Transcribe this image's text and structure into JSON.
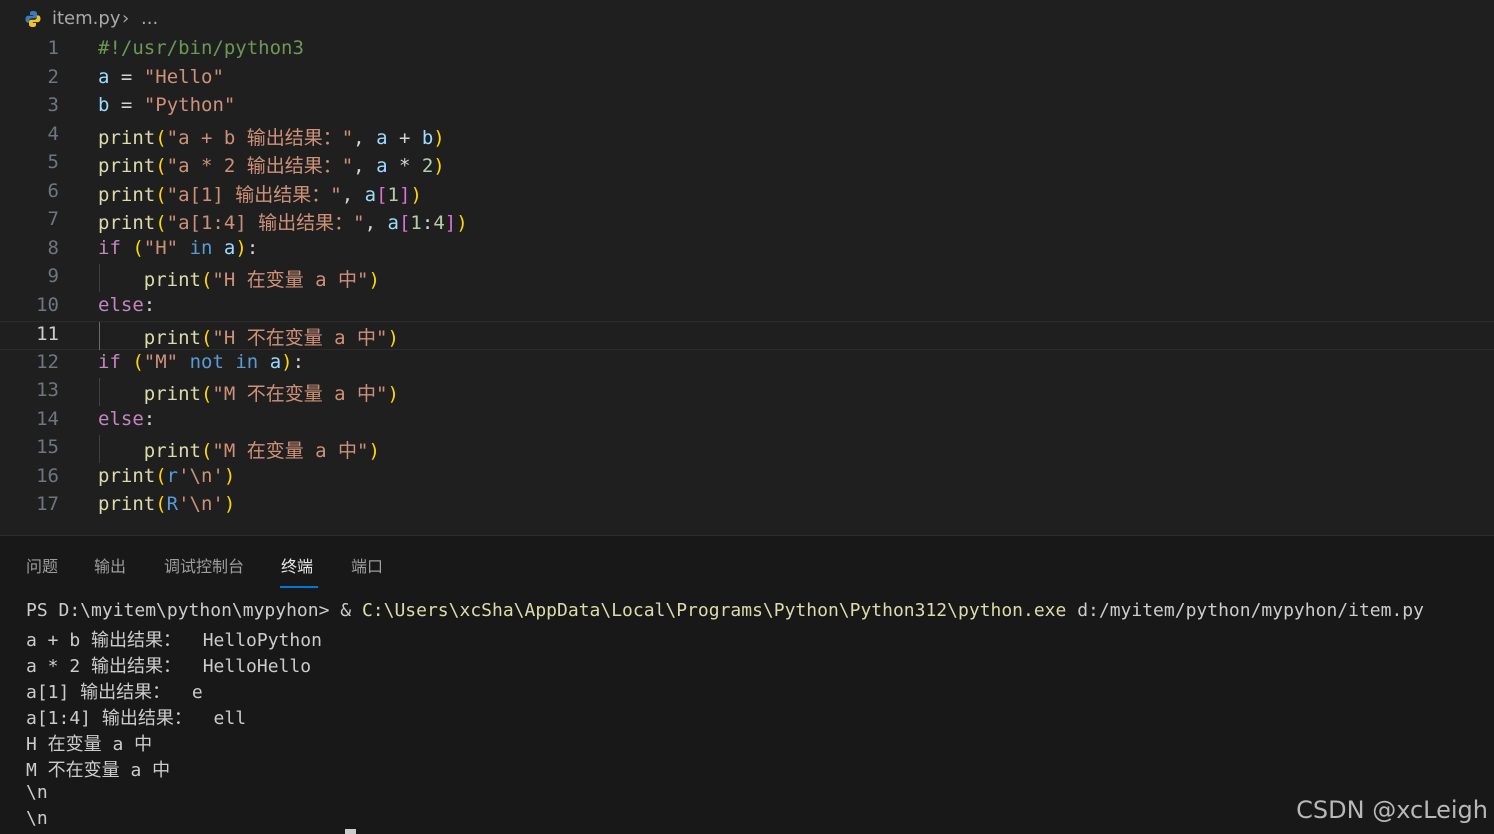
{
  "breadcrumb": {
    "file": "item.py",
    "separator": "›",
    "more": "..."
  },
  "editor": {
    "active_line": 11,
    "line_numbers": [
      "1",
      "2",
      "3",
      "4",
      "5",
      "6",
      "7",
      "8",
      "9",
      "10",
      "11",
      "12",
      "13",
      "14",
      "15",
      "16",
      "17"
    ]
  },
  "panel": {
    "tabs": [
      {
        "label": "问题",
        "active": false
      },
      {
        "label": "输出",
        "active": false
      },
      {
        "label": "调试控制台",
        "active": false
      },
      {
        "label": "终端",
        "active": true
      },
      {
        "label": "端口",
        "active": false
      }
    ]
  },
  "terminal": {
    "prompt": "PS D:\\myitem\\python\\mypyhon> & ",
    "command": "C:\\Users\\xcSha\\AppData\\Local\\Programs\\Python\\Python312\\python.exe",
    "args": " d:/myitem/python/mypyhon/item.py",
    "output": [
      "a + b 输出结果：  HelloPython",
      "a * 2 输出结果：  HelloHello",
      "a[1] 输出结果：  e",
      "a[1:4] 输出结果：  ell",
      "H 在变量 a 中",
      "M 不在变量 a 中",
      "\\n",
      "\\n"
    ]
  },
  "watermark": "CSDN @xcLeigh"
}
